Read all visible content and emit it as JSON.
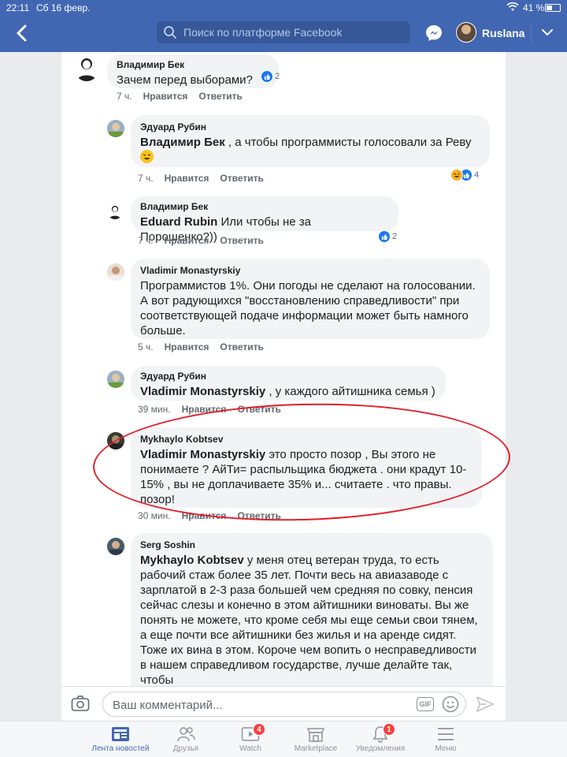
{
  "status_bar": {
    "time": "22:11",
    "date": "Сб 16 февр.",
    "battery": "41 %"
  },
  "nav": {
    "search_placeholder": "Поиск по платформе Facebook",
    "profile_name": "Ruslana"
  },
  "comments": [
    {
      "author": "Владимир Бек",
      "mention": "",
      "text": "Зачем перед выборами?",
      "time": "7 ч.",
      "like_label": "Нравится",
      "reply_label": "Ответить",
      "reaction_count": "2"
    },
    {
      "author": "Эдуард Рубин",
      "mention": "Владимир Бек",
      "text": ", а чтобы программисты голосовали за Реву",
      "time": "7 ч.",
      "like_label": "Нравится",
      "reply_label": "Ответить",
      "reaction_count": "4"
    },
    {
      "author": "Владимир Бек",
      "mention": "Eduard Rubin",
      "text": " Или чтобы не за Порошенко?))",
      "time": "7 ч.",
      "like_label": "Нравится",
      "reply_label": "Ответить",
      "reaction_count": "2"
    },
    {
      "author": "Vladimir Monastyrskiy",
      "mention": "",
      "text": "Программистов 1%. Они погоды не сделают на голосовании. А вот радующихся \"восстановлению справедливости\" при соответствующей подаче информации может быть намного больше.",
      "time": "5 ч.",
      "like_label": "Нравится",
      "reply_label": "Ответить"
    },
    {
      "author": "Эдуард Рубин",
      "mention": "Vladimir Monastyrskiy",
      "text": ", у каждого айтишника семья )",
      "time": "39 мин.",
      "like_label": "Нравится",
      "reply_label": "Ответить"
    },
    {
      "author": "Mykhaylo Kobtsev",
      "mention": "Vladimir Monastyrskiy",
      "text": "  это просто позор , Вы  этого не понимаете ? АйТи= распыльщика бюджета . они крадут 10-15% , вы не доплачиваете 35% и...  считаете . что правы. позор!",
      "time": "30 мин.",
      "like_label": "Нравится",
      "reply_label": "Ответить"
    },
    {
      "author": "Serg Soshin",
      "mention": "Mykhaylo Kobtsev",
      "text": " у меня отец ветеран труда, то есть рабочий стаж более 35 лет. Почти весь на авиазаводе с зарплатой в 2-3 раза большей чем средняя по совку, пенсия сейчас слезы и конечно в этом айтишники виноваты. Вы же понять не можете, что кроме себя мы еще семьи свои тянем, а еще почти все айтишники без жилья и на аренде сидят. Тоже их вина в этом. Короче чем вопить о несправедливости в нашем справедливом государстве, лучше делайте так, чтобы"
    }
  ],
  "comment_input": {
    "placeholder": "Ваш комментарий...",
    "gif_label": "GIF"
  },
  "tabs": [
    {
      "label": "Лента новостей",
      "icon": "news-feed-icon",
      "active": true
    },
    {
      "label": "Друзья",
      "icon": "friends-icon"
    },
    {
      "label": "Watch",
      "icon": "watch-icon",
      "badge": "4"
    },
    {
      "label": "Marketplace",
      "icon": "marketplace-icon"
    },
    {
      "label": "Уведомления",
      "icon": "bell-icon",
      "badge": "1"
    },
    {
      "label": "Меню",
      "icon": "menu-icon"
    }
  ],
  "colors": {
    "brand": "#4267b2",
    "annotation": "#e0202a",
    "like": "#1877f2"
  }
}
